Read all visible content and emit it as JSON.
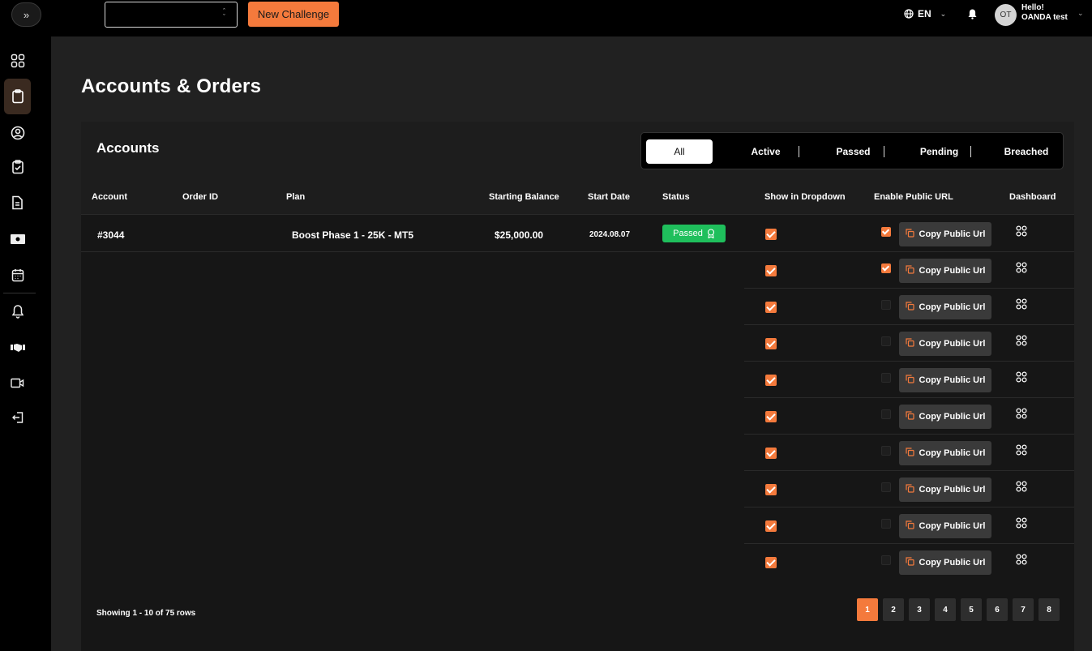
{
  "topbar": {
    "new_challenge_label": "New Challenge",
    "language": "EN",
    "avatar_initials": "OT",
    "greeting": "Hello!",
    "user_name": "OANDA test"
  },
  "page": {
    "title": "Accounts & Orders"
  },
  "card": {
    "title": "Accounts"
  },
  "filters": [
    {
      "label": "All",
      "active": true
    },
    {
      "label": "Active",
      "active": false
    },
    {
      "label": "Passed",
      "active": false
    },
    {
      "label": "Pending",
      "active": false
    },
    {
      "label": "Breached",
      "active": false
    }
  ],
  "table": {
    "headers": {
      "account": "Account",
      "order_id": "Order ID",
      "plan": "Plan",
      "starting_balance": "Starting Balance",
      "start_date": "Start Date",
      "status": "Status",
      "show_in_dropdown": "Show in Dropdown",
      "enable_public_url": "Enable Public URL",
      "dashboard": "Dashboard"
    },
    "first_row": {
      "account": "#3044",
      "order_id": "",
      "plan": "Boost Phase 1 - 25K - MT5",
      "starting_balance": "$25,000.00",
      "start_date": "2024.08.07",
      "status": "Passed"
    },
    "copy_label": "Copy Public Url",
    "rows": [
      {
        "show_in_dropdown": true,
        "public_url": true
      },
      {
        "show_in_dropdown": true,
        "public_url": true
      },
      {
        "show_in_dropdown": true,
        "public_url": false
      },
      {
        "show_in_dropdown": true,
        "public_url": false
      },
      {
        "show_in_dropdown": true,
        "public_url": false
      },
      {
        "show_in_dropdown": true,
        "public_url": false
      },
      {
        "show_in_dropdown": true,
        "public_url": false
      },
      {
        "show_in_dropdown": true,
        "public_url": false
      },
      {
        "show_in_dropdown": true,
        "public_url": false
      },
      {
        "show_in_dropdown": true,
        "public_url": false
      }
    ]
  },
  "footer": {
    "showing": "Showing 1 - 10 of 75 rows",
    "pages": [
      "1",
      "2",
      "3",
      "4",
      "5",
      "6",
      "7",
      "8"
    ],
    "current_page": "1"
  },
  "colors": {
    "accent": "#f47a3c",
    "passed": "#1fbf5c",
    "background": "#212121"
  }
}
